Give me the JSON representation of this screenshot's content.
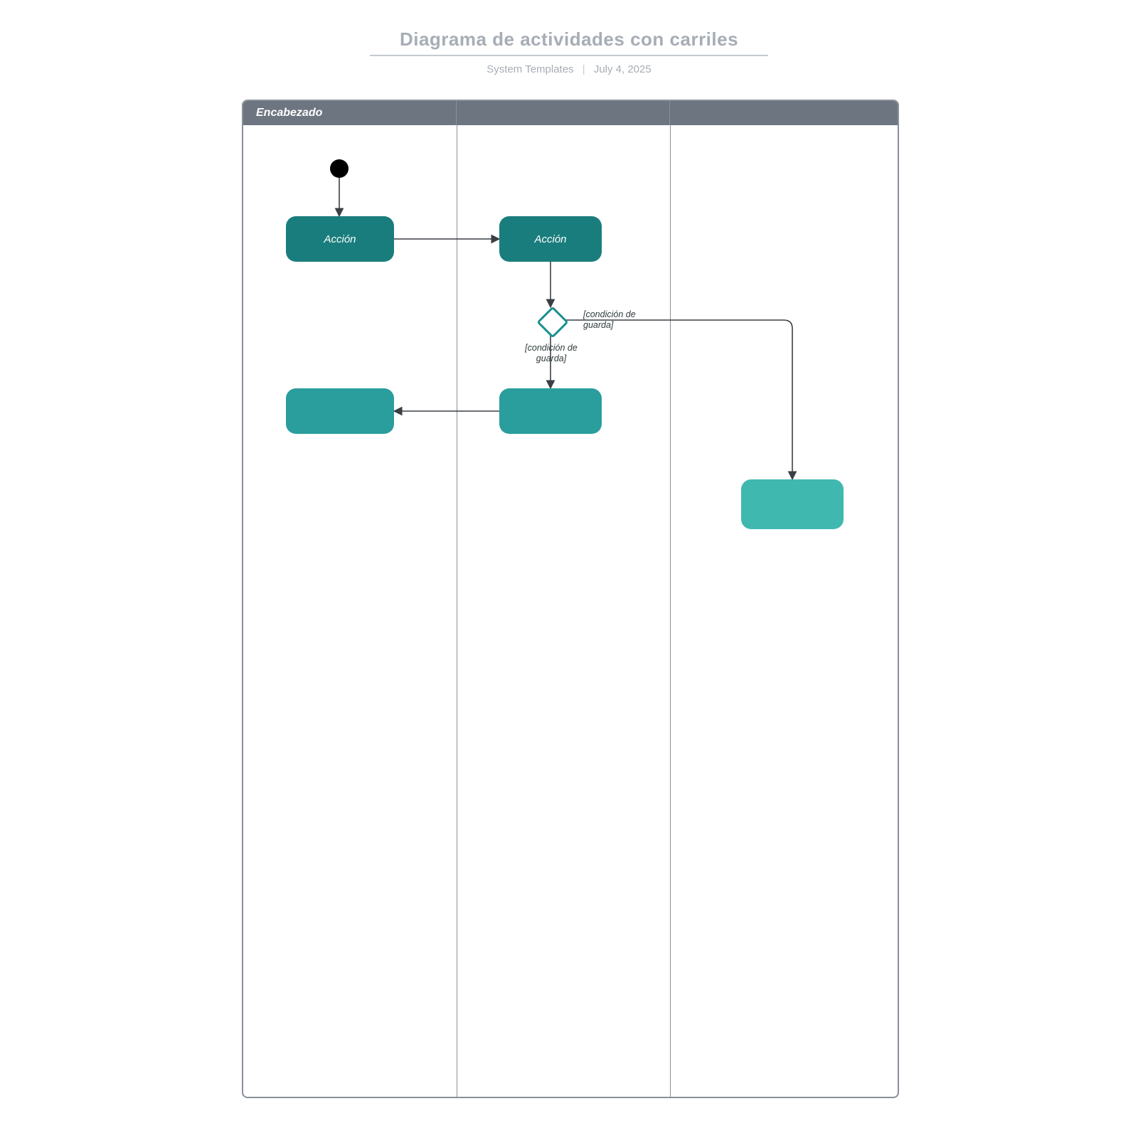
{
  "header": {
    "title": "Diagrama de actividades con carriles",
    "author": "System Templates",
    "date": "July 4, 2025"
  },
  "lanes": {
    "count": 3,
    "widths": [
      300,
      300,
      320
    ],
    "header_label": "Encabezado"
  },
  "nodes": {
    "start": {
      "lane": 0
    },
    "action1": {
      "label": "Acción"
    },
    "action2": {
      "label": "Acción"
    },
    "action3": {
      "label": ""
    },
    "action4": {
      "label": ""
    },
    "action5": {
      "label": ""
    }
  },
  "guards": {
    "g_down": "[condición de guarda]",
    "g_right": "[condición de guarda]"
  },
  "colors": {
    "teal_dark": "#1a7d7d",
    "teal_med": "#2a9d9d",
    "teal_light": "#3fb8b0",
    "frame": "#8a9099",
    "header_bg": "#6d7680"
  }
}
